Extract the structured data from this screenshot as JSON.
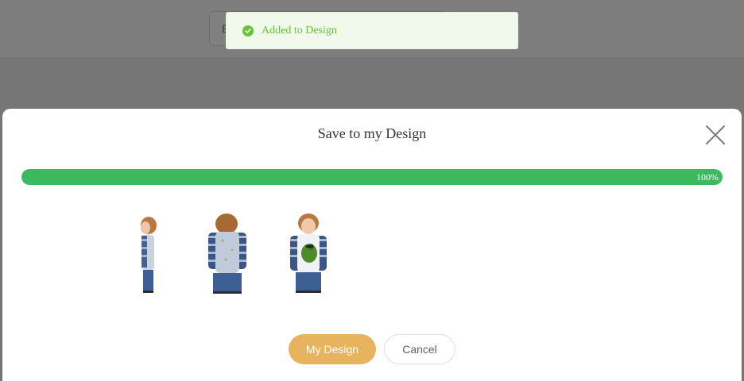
{
  "background": {
    "search_first_letter": "E"
  },
  "toast": {
    "message": "Added to Design",
    "icon": "check-circle-icon",
    "color": "#67c23a"
  },
  "modal": {
    "title": "Save to my Design",
    "close_icon": "close-icon",
    "progress": {
      "value": 1.0,
      "label": "100%",
      "color": "#3cb95f"
    },
    "previews": [
      {
        "name": "side-view"
      },
      {
        "name": "back-view"
      },
      {
        "name": "front-view"
      }
    ],
    "buttons": {
      "my_design": "My Design",
      "cancel": "Cancel"
    },
    "accent_color": "#e8b35f"
  }
}
